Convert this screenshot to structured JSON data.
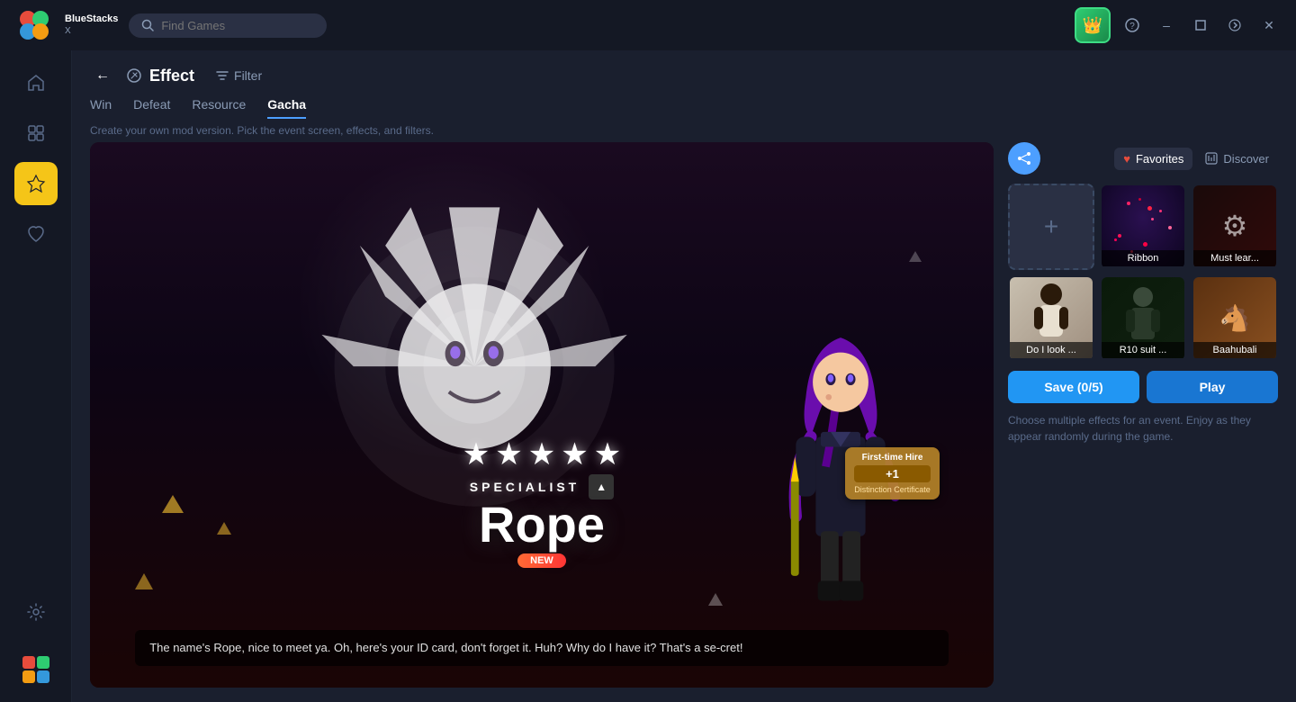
{
  "app": {
    "name": "BlueStacks",
    "version": "X"
  },
  "titlebar": {
    "search_placeholder": "Find Games",
    "minimize_label": "–",
    "maximize_label": "□",
    "forward_label": "→",
    "close_label": "✕",
    "help_label": "?"
  },
  "sidebar": {
    "items": [
      {
        "id": "home",
        "icon": "⌂",
        "label": "Home",
        "active": false
      },
      {
        "id": "apps",
        "icon": "⊞",
        "label": "Apps",
        "active": false
      },
      {
        "id": "effects",
        "icon": "✦",
        "label": "Effects",
        "active": true
      },
      {
        "id": "favorites",
        "icon": "♥",
        "label": "Favorites",
        "active": false
      },
      {
        "id": "settings",
        "icon": "⚙",
        "label": "Settings",
        "active": false
      }
    ],
    "bottom": {
      "logo_icon": "🟩"
    }
  },
  "effect_header": {
    "back_label": "←",
    "effect_label": "Effect",
    "filter_label": "Filter"
  },
  "tabs": {
    "items": [
      {
        "id": "win",
        "label": "Win",
        "active": false
      },
      {
        "id": "defeat",
        "label": "Defeat",
        "active": false
      },
      {
        "id": "resource",
        "label": "Resource",
        "active": false
      },
      {
        "id": "gacha",
        "label": "Gacha",
        "active": true
      }
    ],
    "description": "Create your own mod version. Pick the event screen, effects, and filters."
  },
  "right_panel": {
    "share_icon": "⤴",
    "favorites_label": "Favorites",
    "discover_label": "Discover",
    "add_new_label": "+",
    "thumbnails": [
      {
        "id": "ribbon",
        "label": "Ribbon",
        "bg": "dark-purple",
        "type": "particles"
      },
      {
        "id": "mustlear",
        "label": "Must lear...",
        "bg": "dark-red",
        "type": "scene"
      },
      {
        "id": "dolook",
        "label": "Do I look ...",
        "bg": "light",
        "type": "person"
      },
      {
        "id": "r10",
        "label": "R10 suit ...",
        "bg": "dark-green",
        "type": "person"
      },
      {
        "id": "baahubali",
        "label": "Baahubali",
        "bg": "brown",
        "type": "scene"
      }
    ],
    "save_button": "Save (0/5)",
    "play_button": "Play",
    "hint_text": "Choose multiple effects for an event. Enjoy as they appear randomly during the game."
  },
  "preview": {
    "specialist_label": "SPECIALIST",
    "char_name": "Rope",
    "new_label": "NEW",
    "stars": [
      "★",
      "★",
      "★",
      "★",
      "★"
    ],
    "hire_card": {
      "title": "First-time Hire",
      "badge": "+1",
      "sub": "Distinction Certificate"
    },
    "subtitle": "The name's Rope, nice to meet ya. Oh, here's your ID card, don't forget it. Huh? Why do I have it? That's a se-cret!"
  }
}
